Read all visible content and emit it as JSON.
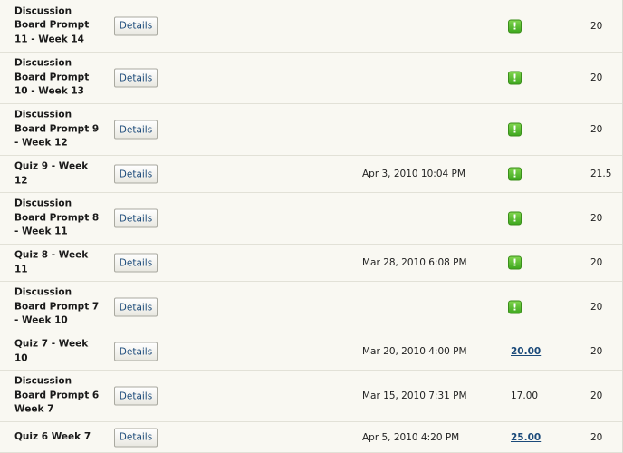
{
  "rows": [
    {
      "title": "Discussion Board Prompt 11 - Week 14",
      "details_label": "Details",
      "date": "",
      "grade_type": "needs-grading",
      "grade": "",
      "points": "20"
    },
    {
      "title": "Discussion Board Prompt 10 - Week 13",
      "details_label": "Details",
      "date": "",
      "grade_type": "needs-grading",
      "grade": "",
      "points": "20"
    },
    {
      "title": "Discussion Board Prompt 9 - Week 12",
      "details_label": "Details",
      "date": "",
      "grade_type": "needs-grading",
      "grade": "",
      "points": "20"
    },
    {
      "title": "Quiz 9 - Week 12",
      "details_label": "Details",
      "date": "Apr 3, 2010 10:04 PM",
      "grade_type": "needs-grading",
      "grade": "",
      "points": "21.5"
    },
    {
      "title": "Discussion Board Prompt 8 - Week 11",
      "details_label": "Details",
      "date": "",
      "grade_type": "needs-grading",
      "grade": "",
      "points": "20"
    },
    {
      "title": "Quiz 8 - Week 11",
      "details_label": "Details",
      "date": "Mar 28, 2010 6:08 PM",
      "grade_type": "needs-grading",
      "grade": "",
      "points": "20"
    },
    {
      "title": "Discussion Board Prompt 7 - Week 10",
      "details_label": "Details",
      "date": "",
      "grade_type": "needs-grading",
      "grade": "",
      "points": "20"
    },
    {
      "title": "Quiz 7 - Week 10",
      "details_label": "Details",
      "date": "Mar 20, 2010 4:00 PM",
      "grade_type": "link",
      "grade": "20.00",
      "points": "20"
    },
    {
      "title": "Discussion Board Prompt 6 Week 7",
      "details_label": "Details",
      "date": "Mar 15, 2010 7:31 PM",
      "grade_type": "text",
      "grade": "17.00",
      "points": "20"
    },
    {
      "title": "Quiz 6 Week 7",
      "details_label": "Details",
      "date": "Apr 5, 2010 4:20 PM",
      "grade_type": "link",
      "grade": "25.00",
      "points": "20"
    }
  ],
  "icons": {
    "needs_grading": "needs-grading-icon",
    "needs_grading_glyph": "!",
    "needs_grading_color": "#4cb82a"
  },
  "colors": {
    "background": "#f9f8f2",
    "link": "#1b4a7a",
    "row_border": "#e2e1d7"
  }
}
